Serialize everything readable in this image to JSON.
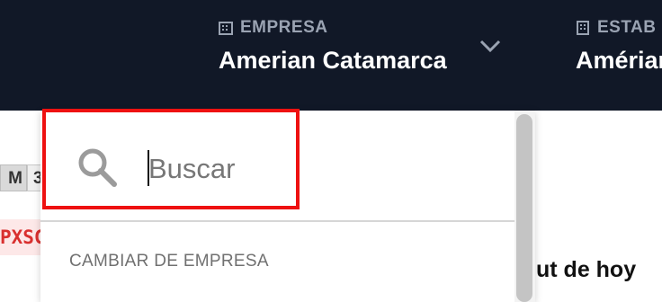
{
  "header": {
    "company_label": "EMPRESA",
    "company_value": "Amerian Catamarca",
    "establishment_label": "ESTAB",
    "establishment_value": "Amérian"
  },
  "background": {
    "chip_m": "M",
    "chip_3": "3",
    "code_snippet": "PXSC",
    "right_text": "ut de hoy"
  },
  "dropdown": {
    "search_placeholder": "Buscar",
    "section_label": "CAMBIAR DE EMPRESA"
  },
  "colors": {
    "header_bg": "#111827",
    "highlight_border": "#ee1111",
    "code_text": "#d9302f"
  },
  "icons": {
    "company": "building-icon",
    "establishment": "building-icon",
    "toggle": "chevron-down-icon",
    "search": "search-icon"
  }
}
